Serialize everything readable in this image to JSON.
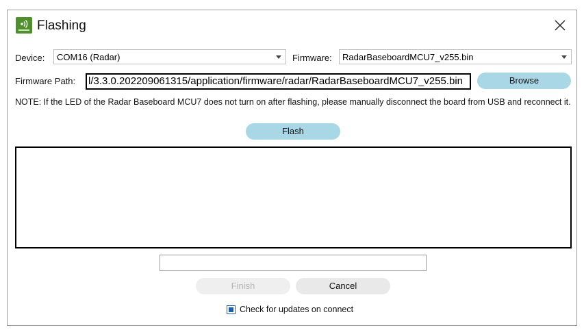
{
  "window": {
    "title": "Flashing",
    "icon": "wifi-signal-app-icon",
    "brand_color": "#4f8f2e"
  },
  "device": {
    "label": "Device:",
    "selected": "COM16 (Radar)"
  },
  "firmware": {
    "label": "Firmware:",
    "selected": "RadarBaseboardMCU7_v255.bin"
  },
  "firmware_path": {
    "label": "Firmware Path:",
    "value": "l/3.3.0.202209061315/application/firmware/radar/RadarBaseboardMCU7_v255.bin"
  },
  "buttons": {
    "browse": "Browse",
    "flash": "Flash",
    "finish": "Finish",
    "cancel": "Cancel"
  },
  "note": "NOTE: If the LED of the Radar Baseboard MCU7 does not turn on after flashing, please manually disconnect the board from USB and reconnect it.",
  "log": "",
  "progress_value": "",
  "check_updates": {
    "label": "Check for updates on connect",
    "checked": true
  },
  "colors": {
    "pill_button": "#a9d7e6",
    "checkbox": "#1f5ea8"
  }
}
